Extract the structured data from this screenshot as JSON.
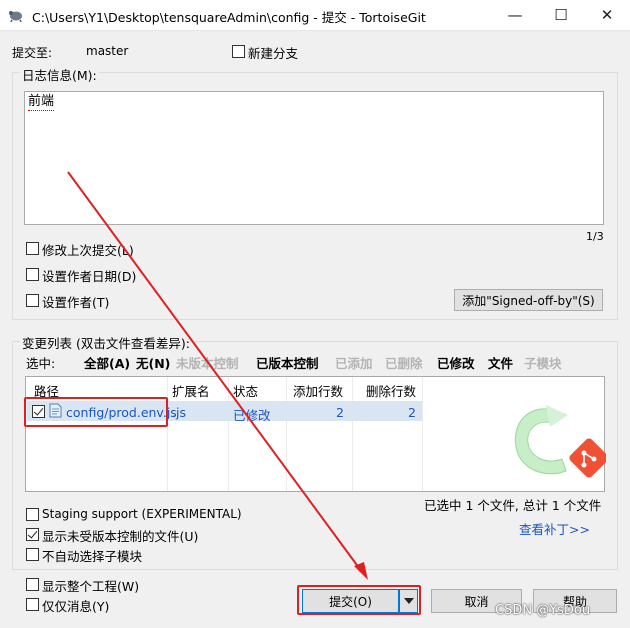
{
  "window": {
    "title": "C:\\Users\\Y1\\Desktop\\tensquareAdmin\\config - 提交 - TortoiseGit",
    "minimize_glyph": "—",
    "maximize_glyph": "☐",
    "close_glyph": "✕"
  },
  "commit_to": {
    "label": "提交至:",
    "branch": "master",
    "new_branch_label": "新建分支",
    "new_branch_checked": false
  },
  "log": {
    "group_label": "日志信息(M):",
    "message": "前端",
    "line_counter": "1/3",
    "amend_label": "修改上次提交(L)",
    "set_author_date_label": "设置作者日期(D)",
    "set_author_label": "设置作者(T)",
    "signoff_button": "添加\"Signed-off-by\"(S)"
  },
  "changes": {
    "group_label": "变更列表 (双击文件查看差异):",
    "select_label": "选中:",
    "filters": {
      "all": "全部(A)",
      "none": "无(N)",
      "unversioned": "未版本控制",
      "versioned": "已版本控制",
      "added": "已添加",
      "deleted": "已删除",
      "modified": "已修改",
      "files": "文件",
      "submodules": "子模块"
    },
    "columns": [
      "路径",
      "扩展名",
      "状态",
      "添加行数",
      "删除行数"
    ],
    "rows": [
      {
        "checked": true,
        "path": "config/prod.env.js",
        "ext": ".js",
        "status": "已修改",
        "added": "2",
        "deleted": "2"
      }
    ],
    "summary": "已选中 1 个文件, 总计 1 个文件",
    "staging_label": "Staging support (EXPERIMENTAL)",
    "staging_checked": false,
    "show_unversioned_label": "显示未受版本控制的文件(U)",
    "show_unversioned_checked": true,
    "no_auto_submodule_label": "不自动选择子模块",
    "no_auto_submodule_checked": false,
    "view_patch_link": "查看补丁>>"
  },
  "footer": {
    "show_whole_project_label": "显示整个工程(W)",
    "message_only_label": "仅仅消息(Y)",
    "commit_button": "提交(O)",
    "cancel_button": "取消",
    "help_button": "帮助",
    "watermark": "CSDN @YsDou"
  },
  "colors": {
    "annotation_red": "#e02020",
    "link_blue": "#1a55c4",
    "selected_row": "#d9e5f3"
  }
}
